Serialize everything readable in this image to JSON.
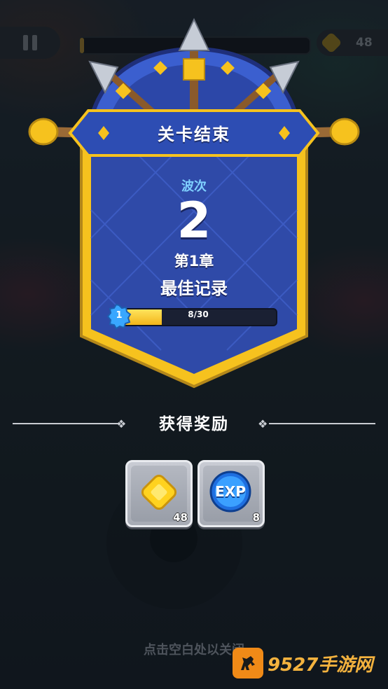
{
  "hud": {
    "coin_count": "48",
    "wave_progress": 0.02
  },
  "panel": {
    "title": "关卡结束",
    "wave_label": "波次",
    "wave_number": "2",
    "chapter": "第1章",
    "record": "最佳记录",
    "level": "1",
    "xp_text": "8/30",
    "xp_fraction": 0.267
  },
  "rewards": {
    "title": "获得奖励",
    "items": [
      {
        "icon": "gold-coin-icon",
        "count": "48"
      },
      {
        "icon": "exp-orb-icon",
        "label": "EXP",
        "count": "8"
      }
    ]
  },
  "hint": "点击空白处以关闭",
  "watermark": "9527手游网",
  "colors": {
    "shield_blue": "#2f4aa8",
    "shield_gold": "#f6c21e",
    "xp_fill": "#f2b51a",
    "wave_label": "#7fd0ff"
  }
}
